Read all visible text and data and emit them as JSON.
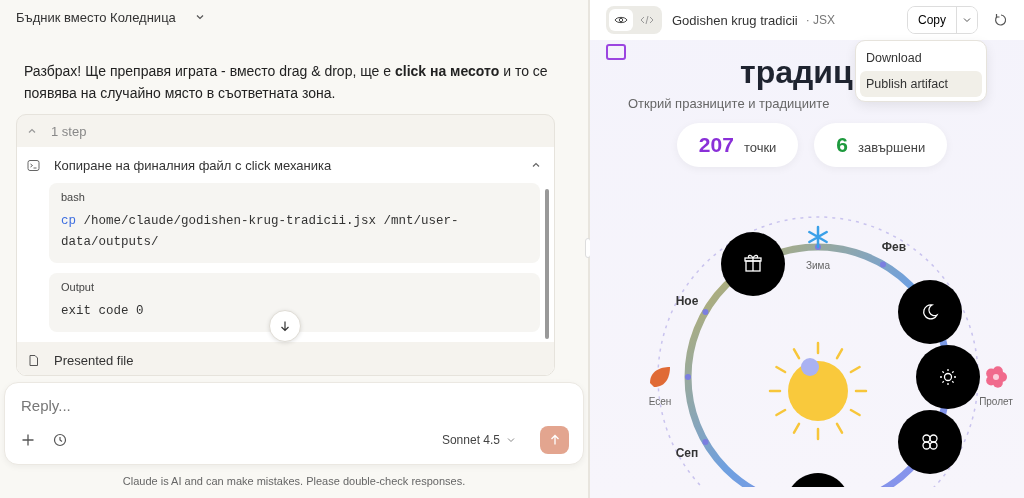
{
  "chat": {
    "title": "Бъдник вместо Коледница",
    "message": "Разбрах! Ще преправя играта - вместо drag & drop, ще е **click на месото** и то се появява на случайно място в съответната зона.",
    "steps": {
      "summary": "1 step",
      "expanded": true,
      "step": {
        "title": "Копиране на финалния файл с click механика",
        "expanded": true,
        "code_label": "bash",
        "command": "cp",
        "args": " /home/claude/godishen-krug-tradicii.jsx /mnt/user-data/outputs/",
        "output_label": "Output",
        "output": "exit code 0"
      },
      "next_step": "Presented file"
    },
    "composer": {
      "placeholder": "Reply...",
      "model": "Sonnet 4.5"
    },
    "disclaimer": "Claude is AI and can make mistakes. Please double-check responses."
  },
  "artifact": {
    "views": [
      {
        "kind": "preview",
        "selected": true
      },
      {
        "kind": "code",
        "selected": false
      }
    ],
    "title": "Godishen krug tradicii",
    "type": "· JSX",
    "copy": "Copy",
    "menu": [
      {
        "label": "Download",
        "selected": false
      },
      {
        "label": "Publish artifact",
        "selected": true
      }
    ],
    "heading": "традиц",
    "subtitle": "Открий празниците и традициите",
    "stats": [
      {
        "value": "207",
        "label": "точки",
        "color": "#8a30d8"
      },
      {
        "value": "6",
        "label": "завършени",
        "color": "#1e9a3e"
      }
    ],
    "wheel": {
      "seasons": [
        {
          "kind": "winter",
          "label": "Зима"
        },
        {
          "kind": "spring",
          "label": "Пролет"
        },
        {
          "kind": "autumn",
          "label": "Есен"
        }
      ],
      "months": [
        "Фев",
        "Ное",
        "Сеп"
      ],
      "events": [
        {
          "kind": "gift"
        },
        {
          "kind": "moon"
        },
        {
          "kind": "sun"
        },
        {
          "kind": "flower"
        },
        {
          "kind": "blank"
        }
      ]
    }
  }
}
